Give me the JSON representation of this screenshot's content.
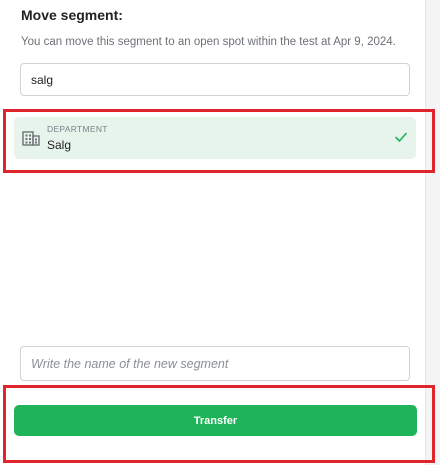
{
  "move_segment": {
    "title": "Move segment:",
    "description": "You can move this segment to an open spot within the test at Apr 9, 2024.",
    "search_value": "salg"
  },
  "results": [
    {
      "kind": "DEPARTMENT",
      "name": "Salg",
      "icon": "building-icon",
      "selected": true
    }
  ],
  "new_segment": {
    "placeholder": "Write the name of the new segment",
    "value": ""
  },
  "actions": {
    "transfer_label": "Transfer"
  },
  "colors": {
    "accent": "#1fb35a",
    "selected_bg": "#e7f4ec",
    "highlight": "#e0242c"
  }
}
